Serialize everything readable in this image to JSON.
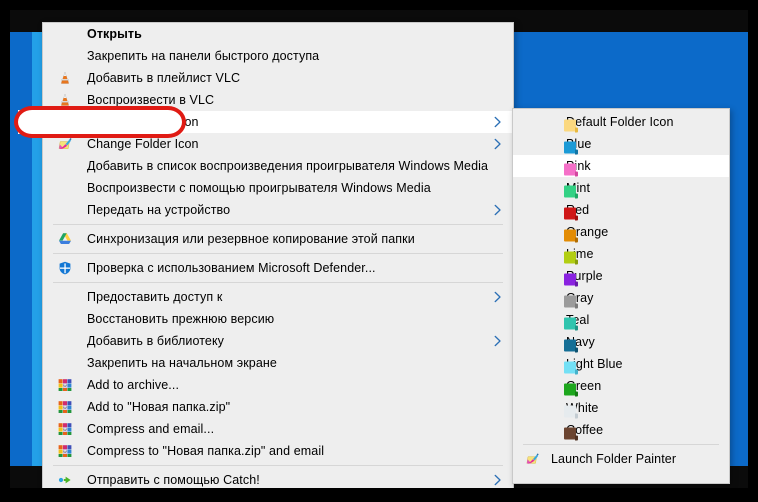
{
  "window": {
    "frame_color": "#000000",
    "desktop_color": "#0c6ac9",
    "accent_color": "#23a0e8"
  },
  "annotation": {
    "color": "#e01b14",
    "shape": "rounded-rect-highlight",
    "target": "Change Folder Icon"
  },
  "context_menu": {
    "background": "#eeeeee",
    "items": [
      {
        "label": "Открыть",
        "icon": "none",
        "bold": true,
        "arrow": false,
        "separator_after": false
      },
      {
        "label": "Закрепить на панели быстрого доступа",
        "icon": "none",
        "bold": false,
        "arrow": false,
        "separator_after": false
      },
      {
        "label": "Добавить в плейлист VLC",
        "icon": "vlc-cone-icon",
        "bold": false,
        "arrow": false,
        "separator_after": false
      },
      {
        "label": "Воспроизвести в VLC",
        "icon": "vlc-cone-icon",
        "bold": false,
        "arrow": false,
        "separator_after": false
      },
      {
        "label": "Change Folder Icon",
        "icon": "folder-painter-icon",
        "bold": false,
        "arrow": true,
        "separator_after": false,
        "highlighted": true
      },
      {
        "label": "Change Folder Icon",
        "icon": "folder-painter-icon",
        "bold": false,
        "arrow": true,
        "separator_after": false
      },
      {
        "label": "Добавить в список воспроизведения проигрывателя Windows Media",
        "icon": "none",
        "bold": false,
        "arrow": false,
        "separator_after": false
      },
      {
        "label": "Воспроизвести с помощью проигрывателя Windows Media",
        "icon": "none",
        "bold": false,
        "arrow": false,
        "separator_after": false
      },
      {
        "label": "Передать на устройство",
        "icon": "none",
        "bold": false,
        "arrow": true,
        "separator_after": true
      },
      {
        "label": "Синхронизация или резервное копирование этой папки",
        "icon": "google-drive-icon",
        "bold": false,
        "arrow": false,
        "separator_after": true
      },
      {
        "label": "Проверка с использованием Microsoft Defender...",
        "icon": "windows-defender-shield-icon",
        "bold": false,
        "arrow": false,
        "separator_after": true
      },
      {
        "label": "Предоставить доступ к",
        "icon": "none",
        "bold": false,
        "arrow": true,
        "separator_after": false
      },
      {
        "label": "Восстановить прежнюю версию",
        "icon": "none",
        "bold": false,
        "arrow": false,
        "separator_after": false
      },
      {
        "label": "Добавить в библиотеку",
        "icon": "none",
        "bold": false,
        "arrow": true,
        "separator_after": false
      },
      {
        "label": "Закрепить на начальном экране",
        "icon": "none",
        "bold": false,
        "arrow": false,
        "separator_after": false
      },
      {
        "label": "Add to archive...",
        "icon": "winrar-icon",
        "bold": false,
        "arrow": false,
        "separator_after": false
      },
      {
        "label": "Add to \"Новая папка.zip\"",
        "icon": "winrar-icon",
        "bold": false,
        "arrow": false,
        "separator_after": false
      },
      {
        "label": "Compress and email...",
        "icon": "winrar-icon",
        "bold": false,
        "arrow": false,
        "separator_after": false
      },
      {
        "label": "Compress to \"Новая папка.zip\" and email",
        "icon": "winrar-icon",
        "bold": false,
        "arrow": false,
        "separator_after": true
      },
      {
        "label": "Отправить с помощью Catch!",
        "icon": "catch-arrows-icon",
        "bold": false,
        "arrow": true,
        "separator_after": false
      }
    ]
  },
  "folder_icon_submenu": {
    "background": "#eeeeee",
    "selected": "Pink",
    "items": [
      {
        "label": "Default Folder Icon",
        "icon": "folder-icon",
        "color": "#fbd87f",
        "tab": "#e8b93f"
      },
      {
        "label": "Blue",
        "icon": "folder-icon",
        "color": "#1b9ad6",
        "tab": "#1275a5"
      },
      {
        "label": "Pink",
        "icon": "folder-icon",
        "color": "#f570c8",
        "tab": "#d3489f"
      },
      {
        "label": "Mint",
        "icon": "folder-icon",
        "color": "#33d184",
        "tab": "#1fa564"
      },
      {
        "label": "Red",
        "icon": "folder-icon",
        "color": "#cf1717",
        "tab": "#9d1010"
      },
      {
        "label": "Orange",
        "icon": "folder-icon",
        "color": "#e38c04",
        "tab": "#b06c02"
      },
      {
        "label": "Lime",
        "icon": "folder-icon",
        "color": "#b2ce12",
        "tab": "#889e0c"
      },
      {
        "label": "Purple",
        "icon": "folder-icon",
        "color": "#8a22e0",
        "tab": "#661aa6"
      },
      {
        "label": "Gray",
        "icon": "folder-icon",
        "color": "#9b9b9b",
        "tab": "#7a7a7a"
      },
      {
        "label": "Teal",
        "icon": "folder-icon",
        "color": "#2fc4ae",
        "tab": "#1f9485"
      },
      {
        "label": "Navy",
        "icon": "folder-icon",
        "color": "#156f96",
        "tab": "#0e5270"
      },
      {
        "label": "Light Blue",
        "icon": "folder-icon",
        "color": "#73e0f5",
        "tab": "#45b3cc"
      },
      {
        "label": "Green",
        "icon": "folder-icon",
        "color": "#1da71d",
        "tab": "#147a14"
      },
      {
        "label": "White",
        "icon": "folder-icon",
        "color": "#e6ebee",
        "tab": "#c3ccd2"
      },
      {
        "label": "Coffee",
        "icon": "folder-icon",
        "color": "#6b4430",
        "tab": "#4e3122"
      }
    ],
    "footer": {
      "label": "Launch Folder Painter",
      "icon": "folder-painter-icon"
    }
  }
}
